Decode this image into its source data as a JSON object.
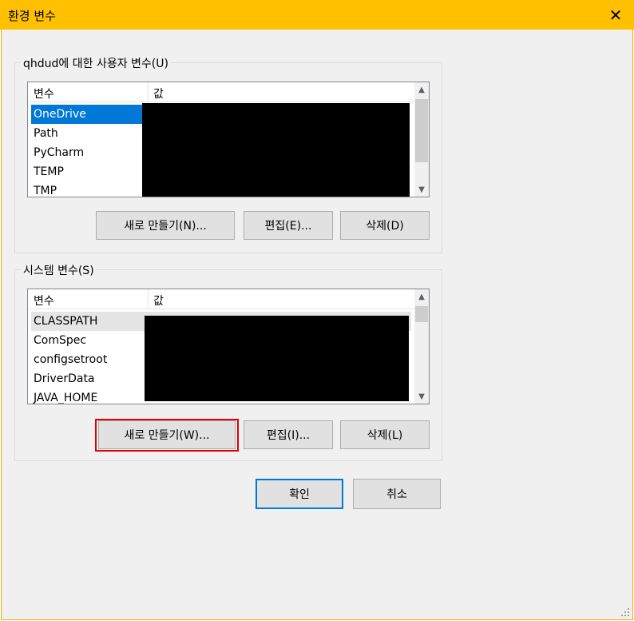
{
  "window": {
    "title": "환경 변수",
    "close_icon": "close-icon"
  },
  "user_vars": {
    "group_label": "qhdud에 대한 사용자 변수(U)",
    "columns": [
      "변수",
      "값"
    ],
    "rows": [
      "OneDrive",
      "Path",
      "PyCharm",
      "TEMP",
      "TMP"
    ],
    "selected_row": "OneDrive",
    "buttons": {
      "new": "새로 만들기(N)...",
      "edit": "편집(E)...",
      "delete": "삭제(D)"
    }
  },
  "system_vars": {
    "group_label": "시스템 변수(S)",
    "columns": [
      "변수",
      "값"
    ],
    "rows": [
      "CLASSPATH",
      "ComSpec",
      "configsetroot",
      "DriverData",
      "JAVA_HOME"
    ],
    "buttons": {
      "new": "새로 만들기(W)...",
      "edit": "편집(I)...",
      "delete": "삭제(L)"
    }
  },
  "footer": {
    "ok": "확인",
    "cancel": "취소"
  },
  "colors": {
    "titlebar": "#ffc000",
    "selection": "#0078d7",
    "highlight_border": "#e00000"
  }
}
